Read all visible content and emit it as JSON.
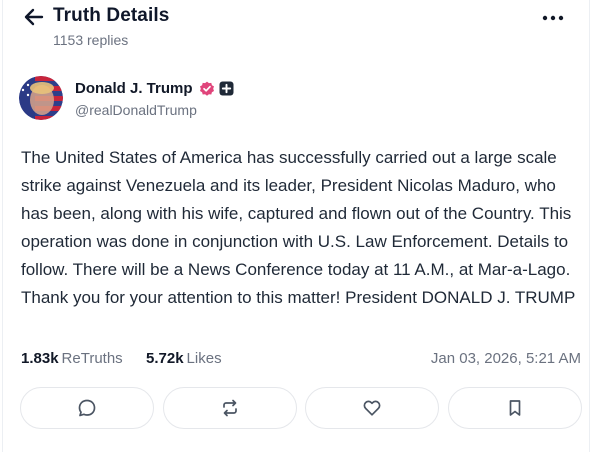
{
  "header": {
    "title": "Truth Details",
    "replies": "1153 replies",
    "back_icon": "arrow-left-icon",
    "more_icon": "more-horizontal-icon"
  },
  "author": {
    "display_name": "Donald J. Trump",
    "handle": "@realDonaldTrump",
    "verified_color": "#e0457b",
    "avatar_icon": "avatar"
  },
  "post": {
    "text": "The United States of America has successfully carried out a large scale strike against Venezuela and its leader, President Nicolas Maduro, who has been, along with his wife, captured and flown out of the Country. This operation was done in conjunction with U.S. Law Enforcement. Details to follow. There will be a News Conference today at 11 A.M., at Mar-a-Lago. Thank you for your attention to this matter! President DONALD J. TRUMP"
  },
  "stats": {
    "retruths_count": "1.83k",
    "retruths_label": "ReTruths",
    "likes_count": "5.72k",
    "likes_label": "Likes",
    "timestamp": "Jan 03, 2026, 5:21 AM"
  },
  "actions": [
    {
      "icon": "reply-icon"
    },
    {
      "icon": "retruth-icon"
    },
    {
      "icon": "heart-icon"
    },
    {
      "icon": "bookmark-icon"
    }
  ]
}
